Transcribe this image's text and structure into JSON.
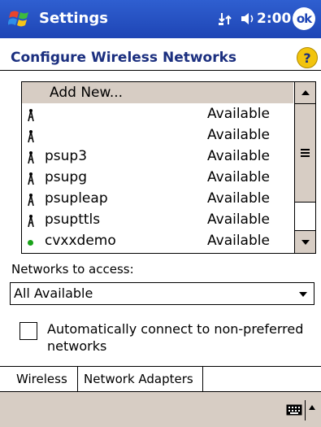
{
  "titlebar": {
    "app_title": "Settings",
    "clock": "2:00",
    "ok_label": "ok",
    "icons": [
      "windows-start-icon",
      "connectivity-icon",
      "volume-icon"
    ]
  },
  "header": {
    "title": "Configure Wireless Networks",
    "help_label": "?"
  },
  "network_list": {
    "add_new_label": "Add New...",
    "rows": [
      {
        "name": "",
        "status": "Available",
        "icon": "antenna-icon"
      },
      {
        "name": "",
        "status": "Available",
        "icon": "antenna-icon"
      },
      {
        "name": "psup3",
        "status": "Available",
        "icon": "antenna-icon"
      },
      {
        "name": "psupg",
        "status": "Available",
        "icon": "antenna-icon"
      },
      {
        "name": "psupleap",
        "status": "Available",
        "icon": "antenna-icon"
      },
      {
        "name": "psupttls",
        "status": "Available",
        "icon": "antenna-icon"
      },
      {
        "name": "cvxxdemo",
        "status": "Available",
        "icon": "connected-dot-icon"
      }
    ]
  },
  "access": {
    "label": "Networks to access:",
    "selected": "All Available"
  },
  "auto_connect": {
    "label": "Automatically connect to non-preferred networks",
    "checked": false
  },
  "tabs": {
    "wireless": "Wireless",
    "network_adapters": "Network Adapters"
  },
  "colors": {
    "titlebar": "#2a56c6",
    "title_text": "#1b2f7f",
    "selection": "#d7cdc4",
    "help_icon": "#f2c40d"
  }
}
